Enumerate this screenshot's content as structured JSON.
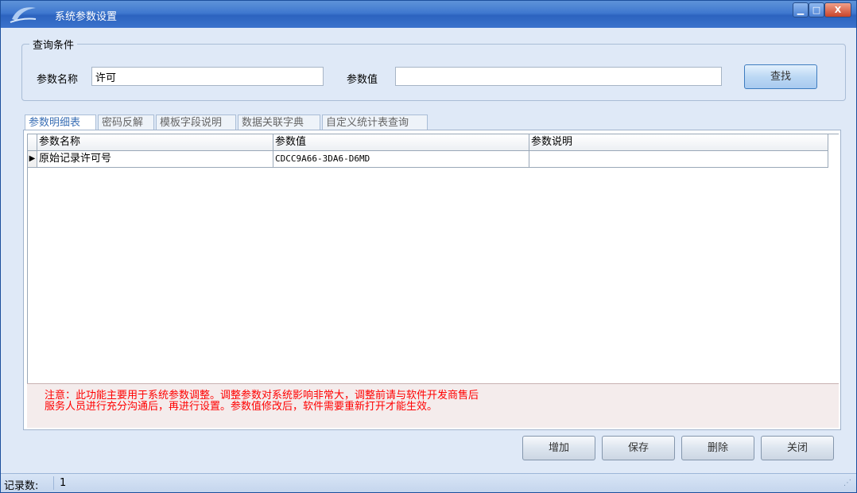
{
  "window": {
    "title": "系统参数设置",
    "controls": {
      "minimize": "▁",
      "maximize": "□",
      "close": "X"
    }
  },
  "query": {
    "group_label": "查询条件",
    "param_name_label": "参数名称",
    "param_name_value": "许可",
    "param_value_label": "参数值",
    "param_value_value": "",
    "find_button": "查找"
  },
  "tabs": [
    {
      "label": "参数明细表",
      "active": true
    },
    {
      "label": "密码反解",
      "active": false
    },
    {
      "label": "模板字段说明",
      "active": false
    },
    {
      "label": "数据关联字典",
      "active": false
    },
    {
      "label": "自定义统计表查询",
      "active": false
    }
  ],
  "grid": {
    "columns": [
      "参数名称",
      "参数值",
      "参数说明"
    ],
    "rows": [
      {
        "indicator": "▶",
        "name": "原始记录许可号",
        "value": "CDCC9A66-3DA6-D6MD",
        "description": ""
      }
    ]
  },
  "notice": {
    "line1": "注意：此功能主要用于系统参数调整。调整参数对系统影响非常大，调整前请与软件开发商售后",
    "line2": "服务人员进行充分沟通后，再进行设置。参数值修改后，软件需要重新打开才能生效。",
    "color": "#ff0000"
  },
  "actions": {
    "add": "增加",
    "save": "保存",
    "delete": "删除",
    "close": "关闭"
  },
  "status": {
    "label": "记录数:",
    "count": "1"
  },
  "colors": {
    "titlebar": "#3f78cf",
    "window_bg": "#dfe9f7",
    "active_tab_text": "#3a6fb5"
  }
}
